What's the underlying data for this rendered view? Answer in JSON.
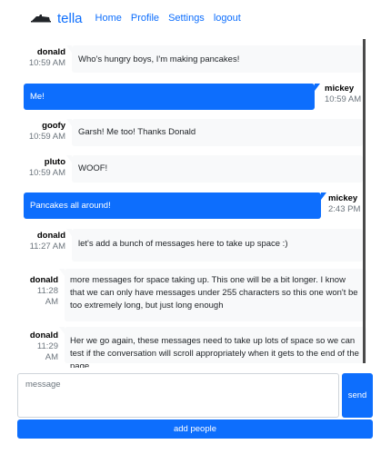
{
  "navbar": {
    "brand": "tella",
    "links": [
      "Home",
      "Profile",
      "Settings",
      "logout"
    ]
  },
  "messages": [
    {
      "sender": "donald",
      "time": "10:59 AM",
      "text": "Who's hungry boys, I'm making pancakes!",
      "own": false
    },
    {
      "sender": "mickey",
      "time": "10:59 AM",
      "text": "Me!",
      "own": true
    },
    {
      "sender": "goofy",
      "time": "10:59 AM",
      "text": "Garsh! Me too! Thanks Donald",
      "own": false
    },
    {
      "sender": "pluto",
      "time": "10:59 AM",
      "text": "WOOF!",
      "own": false
    },
    {
      "sender": "mickey",
      "time": "2:43 PM",
      "text": "Pancakes all around!",
      "own": true
    },
    {
      "sender": "donald",
      "time": "11:27 AM",
      "text": "let's add a bunch of messages here to take up space :)",
      "own": false
    },
    {
      "sender": "donald",
      "time": "11:28 AM",
      "text": "more messages for space taking up. This one will be a bit longer. I know that we can only have messages under 255 characters so this one won't be too extremely long, but just long enough",
      "own": false
    },
    {
      "sender": "donald",
      "time": "11:29 AM",
      "text": "Her we go again, these messages need to take up lots of space so we can test if the conversation will scroll appropriately when it gets to the end of the page",
      "own": false
    }
  ],
  "composer": {
    "placeholder": "message",
    "send_label": "send"
  },
  "add_people_label": "add people",
  "colors": {
    "primary": "#0d6efd",
    "bubble_in": "#f8f9fa"
  }
}
